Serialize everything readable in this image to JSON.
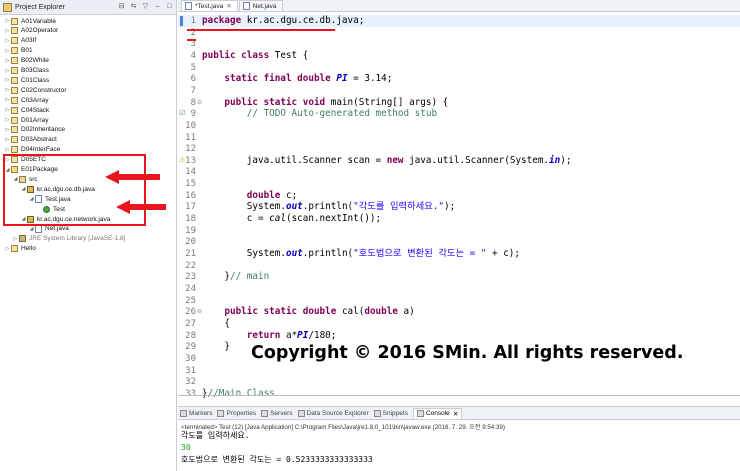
{
  "project_explorer": {
    "title": "Project Explorer",
    "tree": [
      {
        "label": "A01Variable",
        "indent": 0,
        "kind": "project"
      },
      {
        "label": "A02Operator",
        "indent": 0,
        "kind": "project"
      },
      {
        "label": "A03If",
        "indent": 0,
        "kind": "project"
      },
      {
        "label": "B01",
        "indent": 0,
        "kind": "project"
      },
      {
        "label": "B02While",
        "indent": 0,
        "kind": "project"
      },
      {
        "label": "B03Class",
        "indent": 0,
        "kind": "project"
      },
      {
        "label": "C01Class",
        "indent": 0,
        "kind": "project"
      },
      {
        "label": "C02Constructor",
        "indent": 0,
        "kind": "project"
      },
      {
        "label": "C03Array",
        "indent": 0,
        "kind": "project"
      },
      {
        "label": "C04Stack",
        "indent": 0,
        "kind": "project"
      },
      {
        "label": "D01Array",
        "indent": 0,
        "kind": "project"
      },
      {
        "label": "D02Inheritance",
        "indent": 0,
        "kind": "project"
      },
      {
        "label": "D03Abstract",
        "indent": 0,
        "kind": "project"
      },
      {
        "label": "D04InterFace",
        "indent": 0,
        "kind": "project"
      },
      {
        "label": "D05ETC",
        "indent": 0,
        "kind": "project"
      },
      {
        "label": "E01Package",
        "indent": 0,
        "kind": "project-open"
      },
      {
        "label": "src",
        "indent": 1,
        "kind": "src"
      },
      {
        "label": "kr.ac.dgu.ce.db.java",
        "indent": 2,
        "kind": "package"
      },
      {
        "label": "Test.java",
        "indent": 3,
        "kind": "java"
      },
      {
        "label": "Test",
        "indent": 4,
        "kind": "class"
      },
      {
        "label": "kr.ac.dgu.ce.network.java",
        "indent": 2,
        "kind": "package"
      },
      {
        "label": "Net.java",
        "indent": 3,
        "kind": "java"
      },
      {
        "label": "JRE System Library [JavaSE-1.8]",
        "indent": 1,
        "kind": "library"
      },
      {
        "label": "Hello",
        "indent": 0,
        "kind": "project"
      }
    ]
  },
  "editor": {
    "tabs": [
      "*Test.java",
      "Net.java"
    ],
    "lines": [
      {
        "n": "1",
        "html": "<span class='kw'>package</span> kr.ac.dgu.ce.db.java;"
      },
      {
        "n": "2",
        "html": ""
      },
      {
        "n": "3",
        "html": ""
      },
      {
        "n": "4",
        "html": "<span class='kw'>public class</span> Test {"
      },
      {
        "n": "5",
        "html": ""
      },
      {
        "n": "6",
        "html": "    <span class='kw'>static final double</span> <span class='fld'>PI</span> = 3.14;"
      },
      {
        "n": "7",
        "html": ""
      },
      {
        "n": "8",
        "html": "    <span class='kw'>public static void</span> main(String[] args) {"
      },
      {
        "n": "9",
        "html": "        <span class='cm'>// TODO Auto-generated method stub</span>"
      },
      {
        "n": "10",
        "html": ""
      },
      {
        "n": "11",
        "html": ""
      },
      {
        "n": "12",
        "html": ""
      },
      {
        "n": "13",
        "html": "        java.util.Scanner scan = <span class='kw'>new</span> java.util.Scanner(System.<span class='fld'>in</span>);"
      },
      {
        "n": "14",
        "html": ""
      },
      {
        "n": "15",
        "html": ""
      },
      {
        "n": "16",
        "html": "        <span class='kw'>double</span> c;"
      },
      {
        "n": "17",
        "html": "        System.<span class='fld'>out</span>.println(<span class='st'>\"각도를 입력하세요.\"</span>);"
      },
      {
        "n": "18",
        "html": "        c = <span class='itl'>cal</span>(scan.nextInt());"
      },
      {
        "n": "19",
        "html": ""
      },
      {
        "n": "20",
        "html": ""
      },
      {
        "n": "21",
        "html": "        System.<span class='fld'>out</span>.println(<span class='st'>\"호도법으로 변환된 각도는 = \"</span> + c);"
      },
      {
        "n": "22",
        "html": ""
      },
      {
        "n": "23",
        "html": "    }<span class='cm'>// main</span>"
      },
      {
        "n": "24",
        "html": ""
      },
      {
        "n": "25",
        "html": ""
      },
      {
        "n": "26",
        "html": "    <span class='kw'>public static double</span> cal(<span class='kw'>double</span> a)"
      },
      {
        "n": "27",
        "html": "    {"
      },
      {
        "n": "28",
        "html": "        <span class='kw'>return</span> a*<span class='fld'>PI</span>/180;"
      },
      {
        "n": "29",
        "html": "    }"
      },
      {
        "n": "30",
        "html": ""
      },
      {
        "n": "31",
        "html": ""
      },
      {
        "n": "32",
        "html": ""
      },
      {
        "n": "33",
        "html": "}<span class='cm'>//Main Class</span>"
      }
    ],
    "watermark": "Copyright © 2016 SMin. All rights reserved."
  },
  "console": {
    "tabs": [
      "Markers",
      "Properties",
      "Servers",
      "Data Source Explorer",
      "Snippets",
      "Console"
    ],
    "active_tab": "Console",
    "terminated": "<terminated> Test (12) [Java Application] C:\\Program Files\\Java\\jre1.8.0_101\\bin\\javaw.exe (2016. 7. 29. 오전 9:54:39)",
    "output": [
      {
        "text": "각도를 입력하세요.",
        "type": "out"
      },
      {
        "text": "30",
        "type": "in"
      },
      {
        "text": "호도법으로 변환된 각도는 = 0.5233333333333333",
        "type": "out"
      }
    ]
  },
  "colors": {
    "keyword": "#7f0055",
    "comment": "#3f7f5f",
    "string": "#2a00ff",
    "field": "#0000c0",
    "annotation_red": "#e8151f",
    "console_input": "#19a019"
  }
}
